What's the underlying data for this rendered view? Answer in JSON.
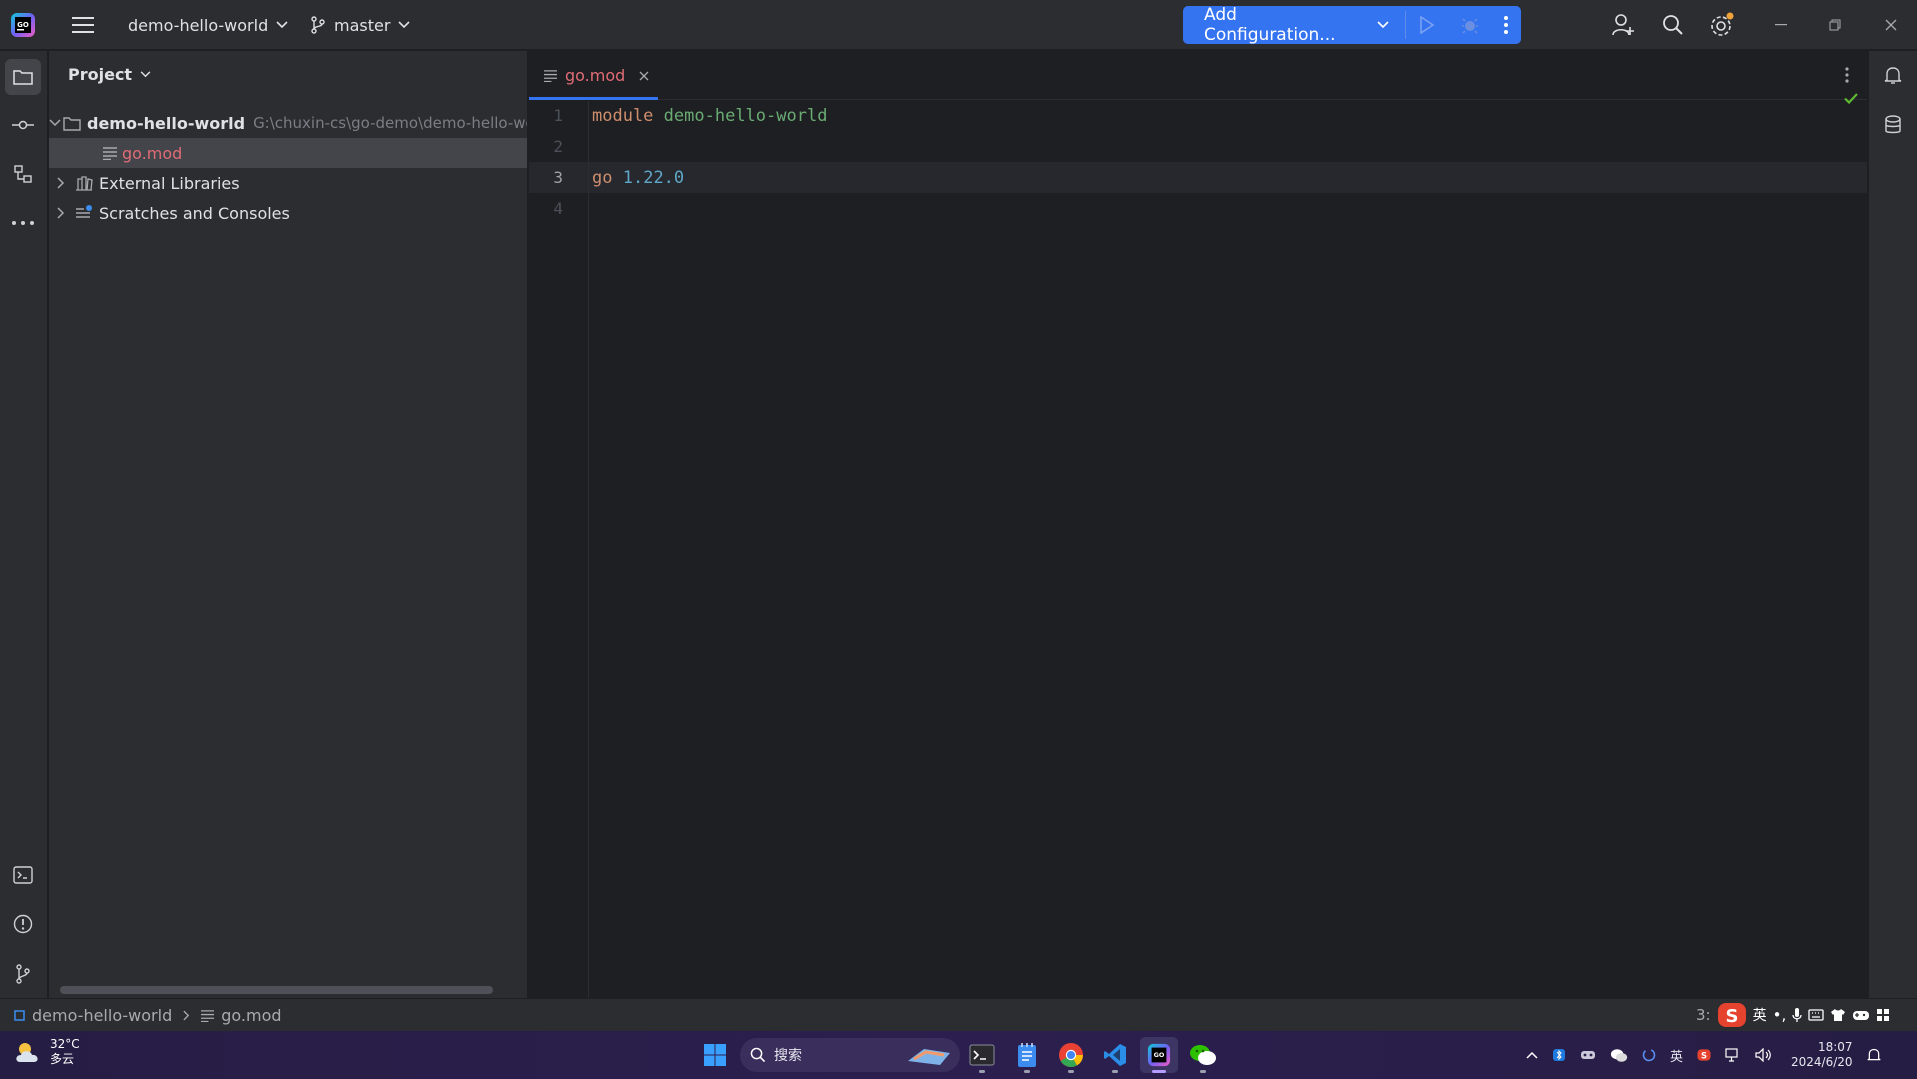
{
  "titlebar": {
    "project_name": "demo-hello-world",
    "branch": "master",
    "run_config_label": "Add Configuration..."
  },
  "project_panel": {
    "title": "Project",
    "tree": {
      "root_name": "demo-hello-world",
      "root_path": "G:\\chuxin-cs\\go-demo\\demo-hello-wo",
      "file": "go.mod",
      "external_libraries": "External Libraries",
      "scratches": "Scratches and Consoles"
    }
  },
  "editor": {
    "tab_label": "go.mod",
    "line_numbers": [
      "1",
      "2",
      "3",
      "4"
    ],
    "lines": {
      "l1_keyword": "module",
      "l1_value": "demo-hello-world",
      "l3_keyword": "go",
      "l3_value": "1.22.0"
    },
    "current_line": 3
  },
  "statusbar": {
    "breadcrumb_project": "demo-hello-world",
    "breadcrumb_file": "go.mod",
    "cursor_pos": "3:",
    "ime_mode": "英"
  },
  "taskbar": {
    "weather_temp": "32°C",
    "weather_desc": "多云",
    "search_label": "搜索",
    "ime_lang": "英",
    "time": "18:07",
    "date": "2024/6/20"
  },
  "colors": {
    "accent": "#3574f0",
    "keyword": "#cf8e6d",
    "string_value": "#6aab73",
    "number_value": "#5fa7c7",
    "modified_file": "#e06c75",
    "check": "#5fb832"
  }
}
